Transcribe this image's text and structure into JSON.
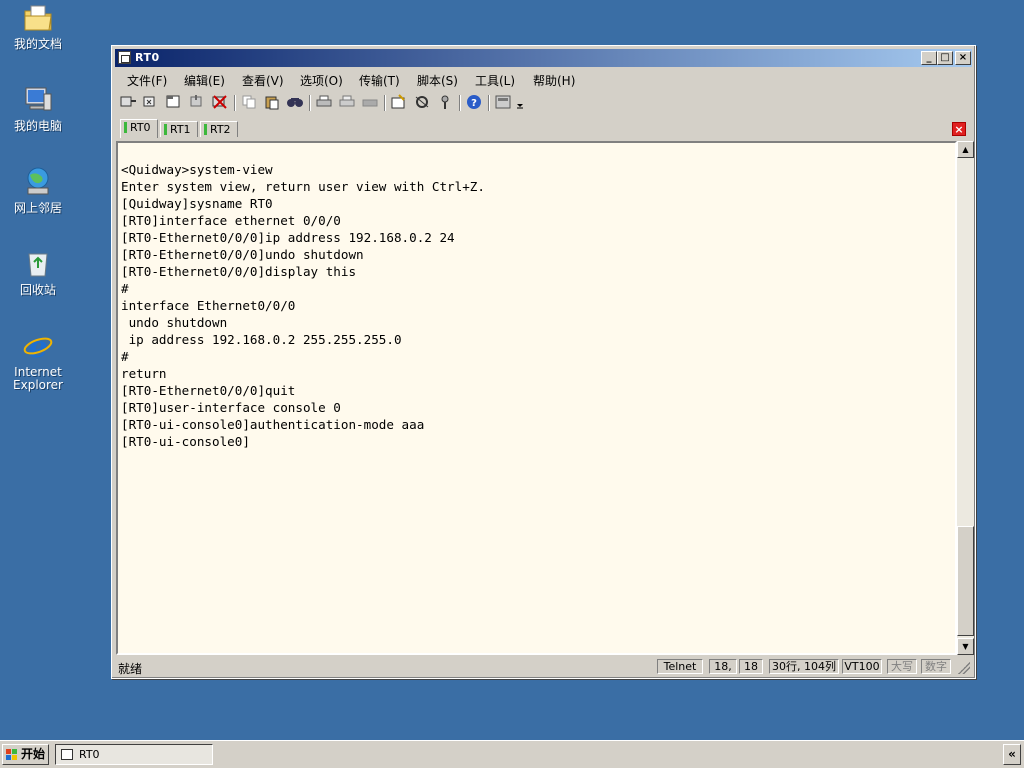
{
  "desktop": {
    "icons": [
      {
        "label": "我的文档",
        "icon": "folder-documents-icon"
      },
      {
        "label": "我的电脑",
        "icon": "computer-icon"
      },
      {
        "label": "网上邻居",
        "icon": "network-icon"
      },
      {
        "label": "回收站",
        "icon": "recycle-bin-icon"
      },
      {
        "label": "Internet Explorer",
        "icon": "internet-explorer-icon"
      }
    ]
  },
  "window": {
    "title": "RT0",
    "controls": {
      "minimize": "_",
      "maximize": "□",
      "close": "×"
    }
  },
  "menu": [
    {
      "label": "文件(F)"
    },
    {
      "label": "编辑(E)"
    },
    {
      "label": "查看(V)"
    },
    {
      "label": "选项(O)"
    },
    {
      "label": "传输(T)"
    },
    {
      "label": "脚本(S)"
    },
    {
      "label": "工具(L)"
    },
    {
      "label": "帮助(H)"
    }
  ],
  "toolbar": {
    "icons": [
      "connect-icon",
      "quick-connect-icon",
      "connect-tab-icon",
      "reconnect-icon",
      "disconnect-icon",
      "copy-icon",
      "paste-icon",
      "find-icon",
      "print-icon",
      "print-setup-icon",
      "print-screen-icon",
      "session-options-icon",
      "global-options-icon",
      "keymap-icon",
      "help-icon",
      "sftp-icon",
      "more-icon"
    ]
  },
  "tabs": [
    {
      "label": "RT0",
      "active": true
    },
    {
      "label": "RT1",
      "active": false
    },
    {
      "label": "RT2",
      "active": false
    }
  ],
  "terminal": {
    "lines": [
      "<Quidway>system-view",
      "Enter system view, return user view with Ctrl+Z.",
      "[Quidway]sysname RT0",
      "[RT0]interface ethernet 0/0/0",
      "[RT0-Ethernet0/0/0]ip address 192.168.0.2 24",
      "[RT0-Ethernet0/0/0]undo shutdown",
      "[RT0-Ethernet0/0/0]display this",
      "#",
      "interface Ethernet0/0/0",
      " undo shutdown",
      " ip address 192.168.0.2 255.255.255.0",
      "#",
      "return",
      "[RT0-Ethernet0/0/0]quit",
      "[RT0]user-interface console 0",
      "[RT0-ui-console0]authentication-mode aaa",
      "[RT0-ui-console0]"
    ]
  },
  "status": {
    "ready": "就绪",
    "protocol": "Telnet",
    "row": "18,",
    "col": "18",
    "size": "30行, 104列",
    "emulation": "VT100",
    "caps": "大写",
    "num": "数字"
  },
  "taskbar": {
    "start": "开始",
    "task": "RT0",
    "tray_toggle": "«"
  }
}
